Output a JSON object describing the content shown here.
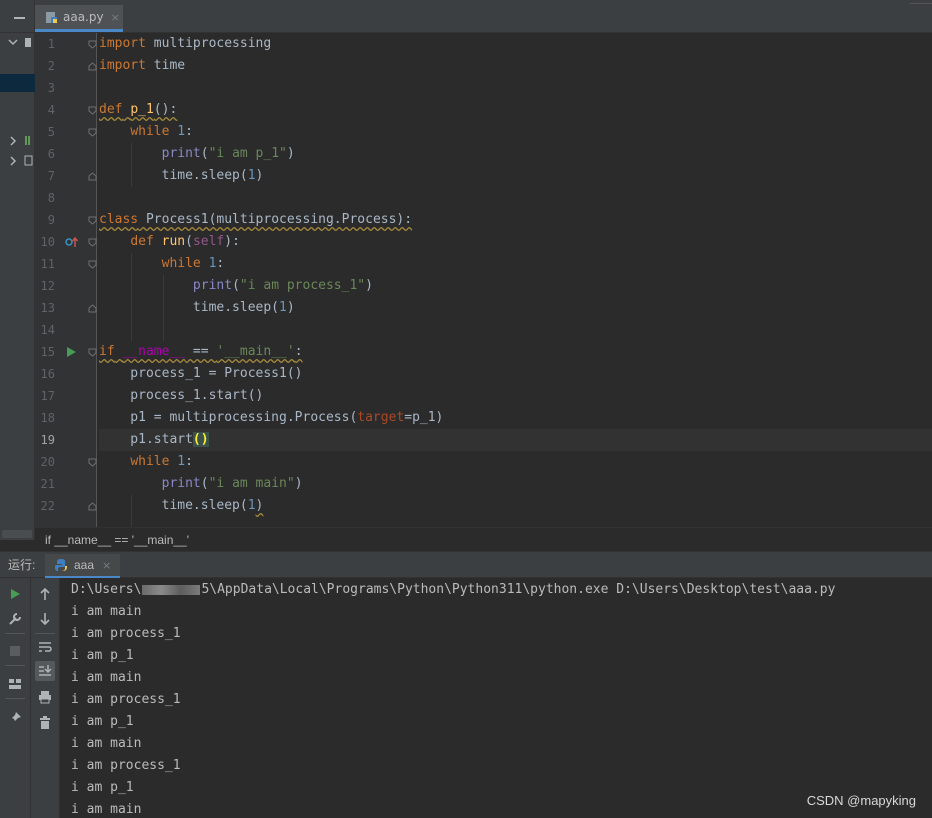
{
  "tab": {
    "filename": "aaa.py",
    "close": "×"
  },
  "editor": {
    "line_numbers": [
      "1",
      "2",
      "3",
      "4",
      "5",
      "6",
      "7",
      "8",
      "9",
      "10",
      "11",
      "12",
      "13",
      "14",
      "15",
      "16",
      "17",
      "18",
      "19",
      "20",
      "21",
      "22"
    ],
    "current_line": 19
  },
  "breadcrumb": "if __name__ == '__main__'",
  "run_panel": {
    "label": "运行:",
    "tab_name": "aaa",
    "tab_close": "×",
    "command_prefix": "D:\\Users\\",
    "command_suffix": "5\\AppData\\Local\\Programs\\Python\\Python311\\python.exe D:\\Users\\Desktop\\test\\aaa.py",
    "output_lines": [
      "i am main",
      "i am process_1",
      "i am p_1",
      "i am main",
      "i am process_1",
      "i am p_1",
      "i am main",
      "i am process_1",
      "i am p_1",
      "i am main"
    ]
  },
  "watermark": "CSDN @mapyking",
  "colors": {
    "accent": "#4a88c7",
    "keyword": "#cc7832",
    "string": "#6a8759",
    "number": "#6897bb",
    "function": "#ffc66d",
    "background": "#2b2b2b"
  }
}
